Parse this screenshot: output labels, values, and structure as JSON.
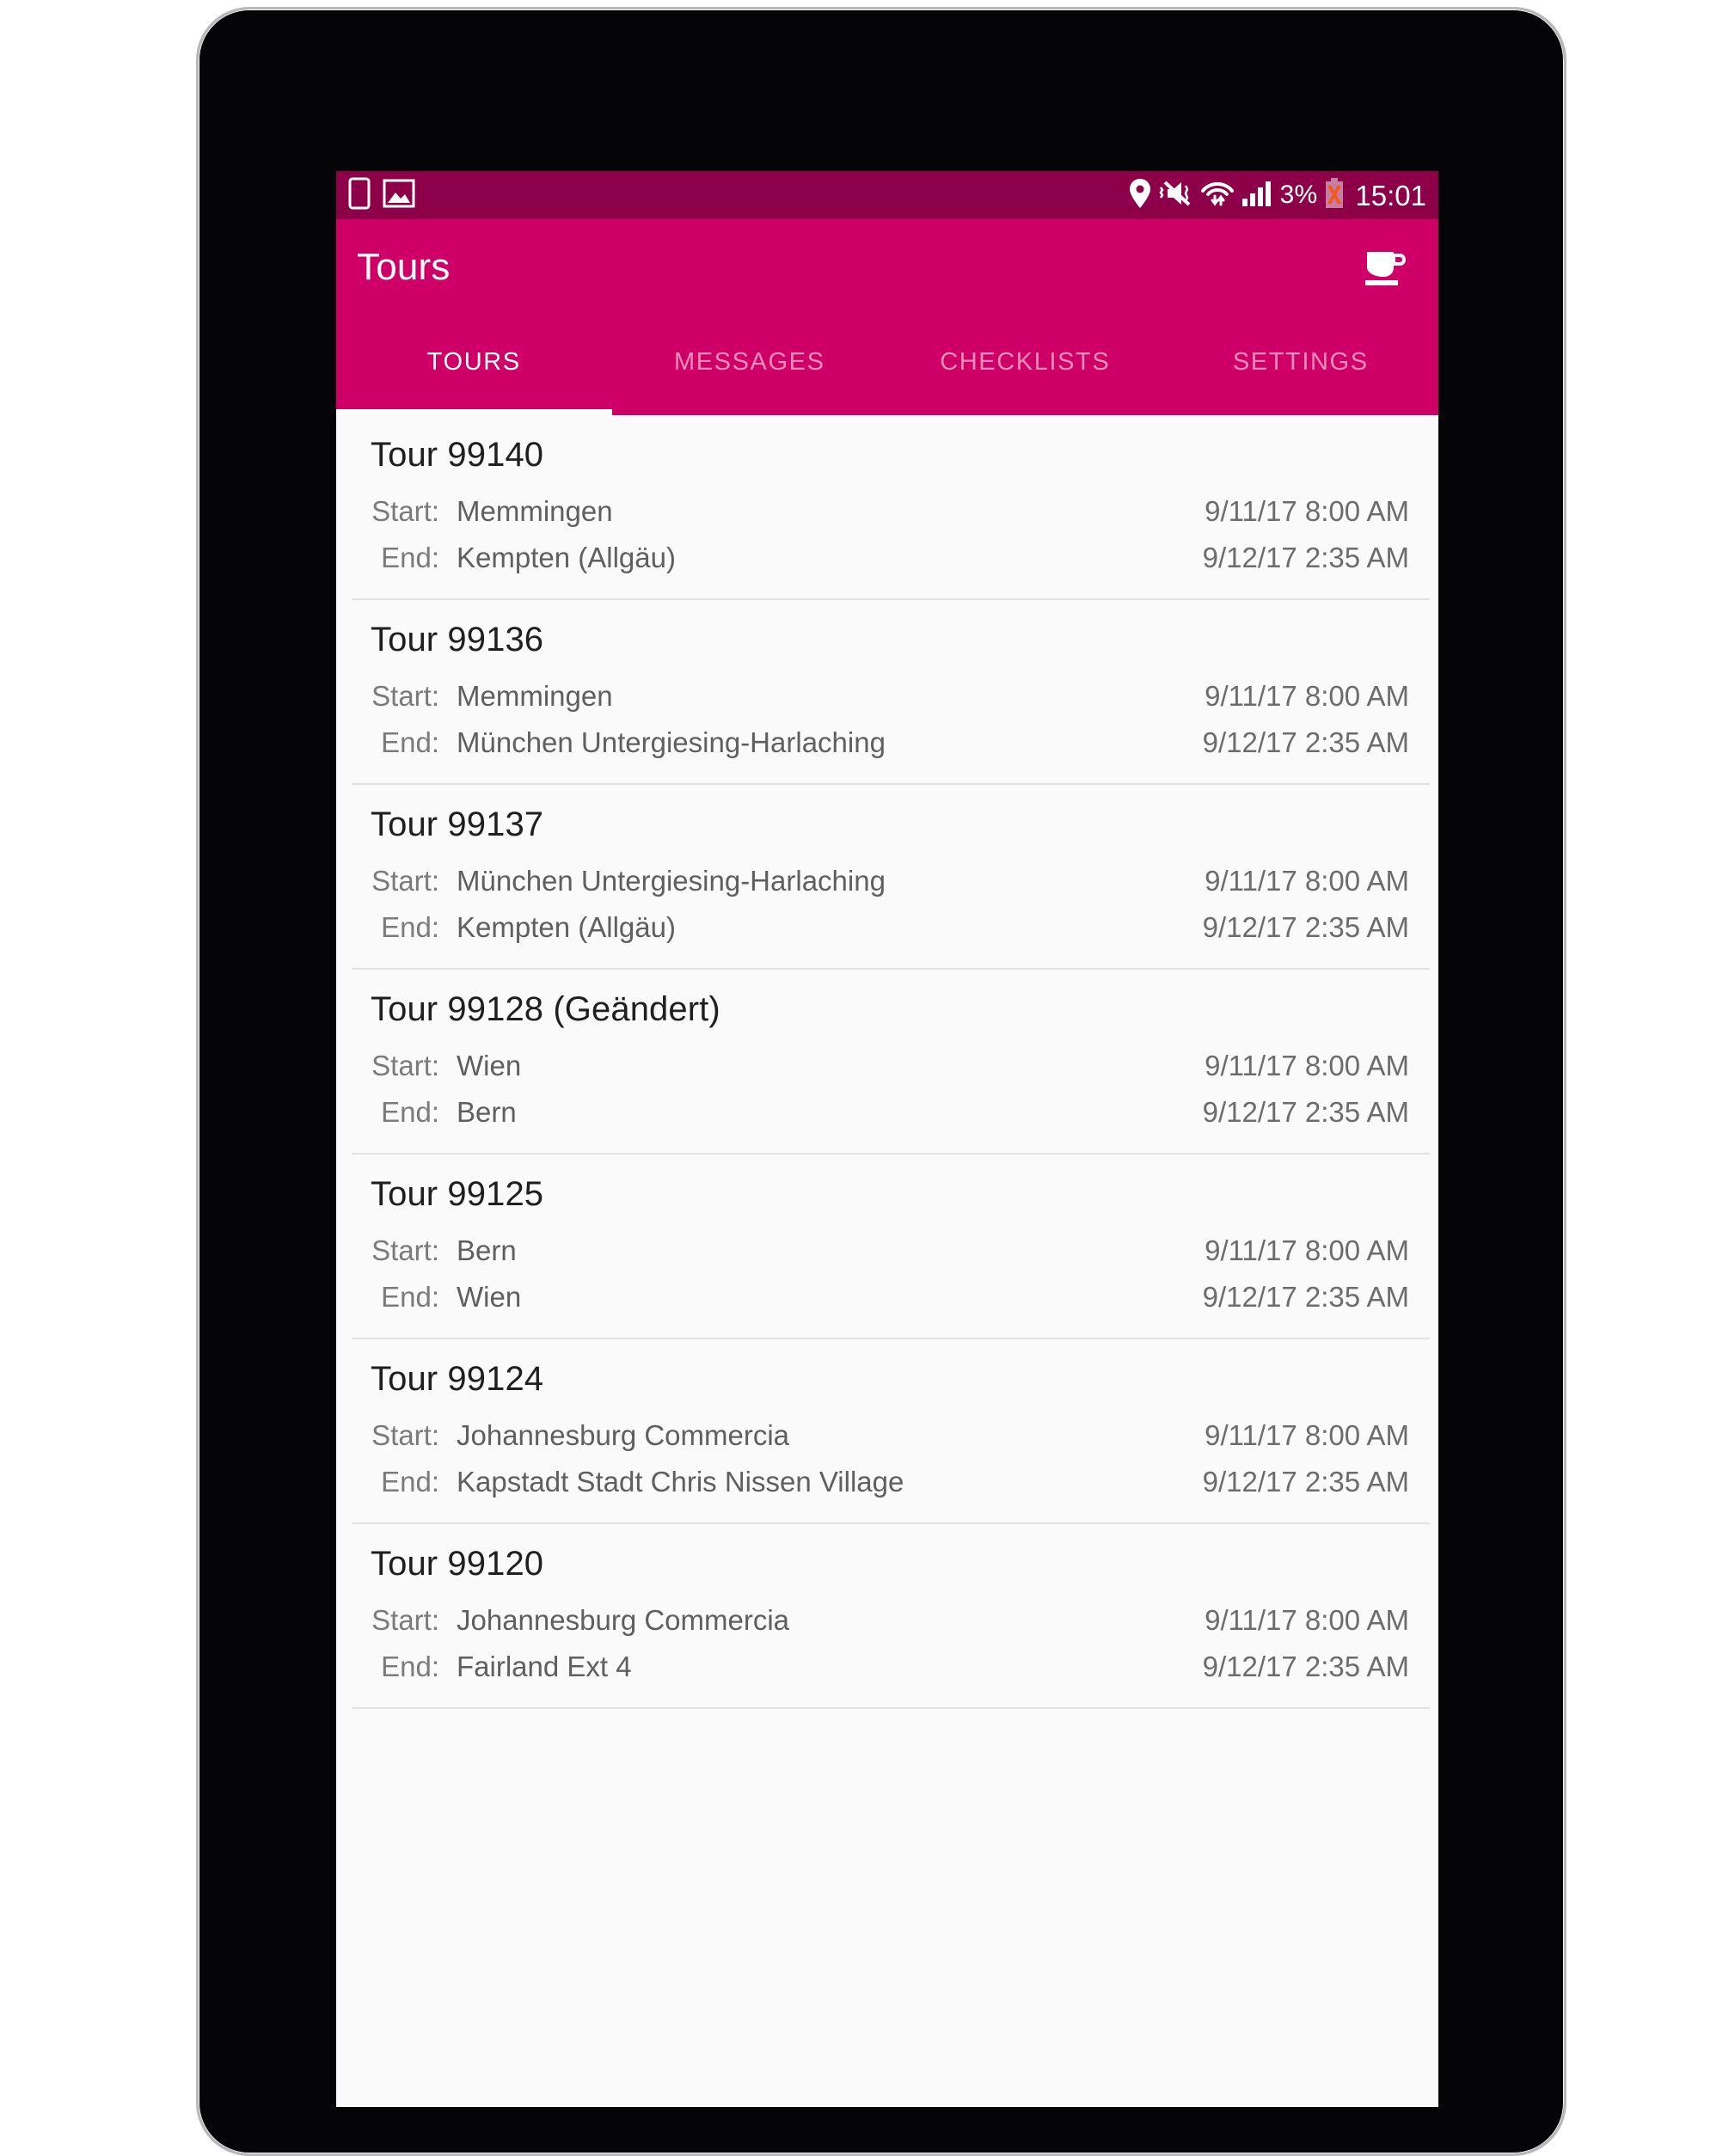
{
  "status_bar": {
    "left_icons": [
      "device-icon",
      "image-icon"
    ],
    "right_icons": [
      "location-pin-icon",
      "vibrate-mute-icon",
      "wifi-transfer-icon",
      "signal-bars-icon"
    ],
    "battery_percent": "3%",
    "battery_icon": "battery-low-icon",
    "clock": "15:01",
    "background": "#8d0049"
  },
  "app_bar": {
    "title": "Tours",
    "action_icon": "coffee-cup-icon",
    "background": "#ce0067"
  },
  "tabs": [
    {
      "label": "TOURS",
      "active": true
    },
    {
      "label": "MESSAGES",
      "active": false
    },
    {
      "label": "CHECKLISTS",
      "active": false
    },
    {
      "label": "SETTINGS",
      "active": false
    }
  ],
  "labels": {
    "start": "Start:",
    "end": "End:"
  },
  "tours": [
    {
      "title": "Tour 99140",
      "start_place": "Memmingen",
      "start_time": "9/11/17 8:00 AM",
      "end_place": "Kempten (Allgäu)",
      "end_time": "9/12/17 2:35 AM"
    },
    {
      "title": "Tour 99136",
      "start_place": "Memmingen",
      "start_time": "9/11/17 8:00 AM",
      "end_place": "München Untergiesing-Harlaching",
      "end_time": "9/12/17 2:35 AM"
    },
    {
      "title": "Tour 99137",
      "start_place": "München Untergiesing-Harlaching",
      "start_time": "9/11/17 8:00 AM",
      "end_place": "Kempten (Allgäu)",
      "end_time": "9/12/17 2:35 AM"
    },
    {
      "title": "Tour 99128 (Geändert)",
      "start_place": "Wien",
      "start_time": "9/11/17 8:00 AM",
      "end_place": "Bern",
      "end_time": "9/12/17 2:35 AM"
    },
    {
      "title": "Tour 99125",
      "start_place": "Bern",
      "start_time": "9/11/17 8:00 AM",
      "end_place": "Wien",
      "end_time": "9/12/17 2:35 AM"
    },
    {
      "title": "Tour 99124",
      "start_place": "Johannesburg Commercia",
      "start_time": "9/11/17 8:00 AM",
      "end_place": "Kapstadt Stadt Chris Nissen Village",
      "end_time": "9/12/17 2:35 AM"
    },
    {
      "title": "Tour 99120",
      "start_place": "Johannesburg Commercia",
      "start_time": "9/11/17 8:00 AM",
      "end_place": "Fairland Ext 4",
      "end_time": "9/12/17 2:35 AM"
    }
  ]
}
